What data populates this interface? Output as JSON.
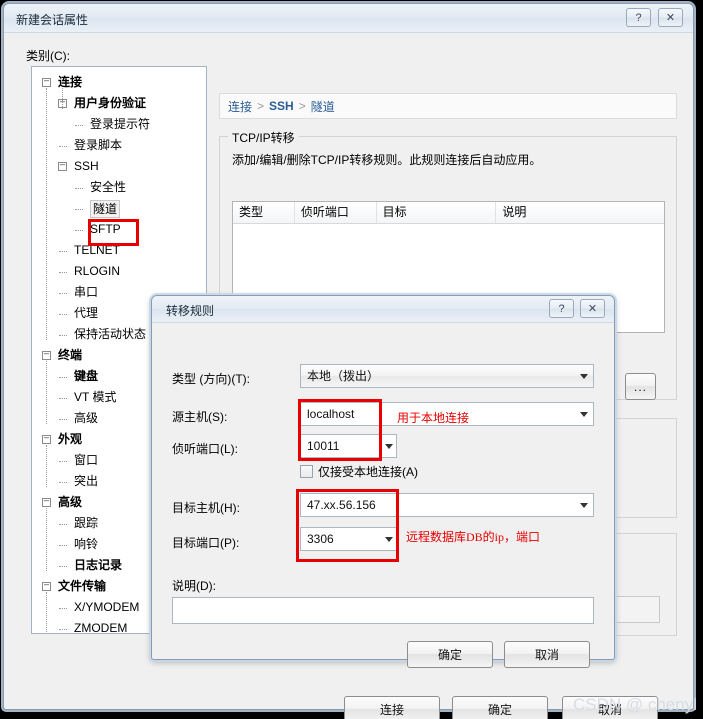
{
  "window": {
    "title": "新建会话属性",
    "help_button": "?",
    "close_button": "✕",
    "category_label": "类别(C):"
  },
  "tree": {
    "items": [
      {
        "label": "连接",
        "depth": 0,
        "bold": true,
        "expander": true,
        "selected": false
      },
      {
        "label": "用户身份验证",
        "depth": 1,
        "bold": true,
        "expander": true,
        "selected": false
      },
      {
        "label": "登录提示符",
        "depth": 2,
        "bold": false,
        "expander": false,
        "selected": false
      },
      {
        "label": "登录脚本",
        "depth": 1,
        "bold": false,
        "expander": false,
        "selected": false
      },
      {
        "label": "SSH",
        "depth": 1,
        "bold": false,
        "expander": true,
        "selected": false
      },
      {
        "label": "安全性",
        "depth": 2,
        "bold": false,
        "expander": false,
        "selected": false
      },
      {
        "label": "隧道",
        "depth": 2,
        "bold": false,
        "expander": false,
        "selected": true
      },
      {
        "label": "SFTP",
        "depth": 2,
        "bold": false,
        "expander": false,
        "selected": false
      },
      {
        "label": "TELNET",
        "depth": 1,
        "bold": false,
        "expander": false,
        "selected": false
      },
      {
        "label": "RLOGIN",
        "depth": 1,
        "bold": false,
        "expander": false,
        "selected": false
      },
      {
        "label": "串口",
        "depth": 1,
        "bold": false,
        "expander": false,
        "selected": false
      },
      {
        "label": "代理",
        "depth": 1,
        "bold": false,
        "expander": false,
        "selected": false
      },
      {
        "label": "保持活动状态",
        "depth": 1,
        "bold": false,
        "expander": false,
        "selected": false
      },
      {
        "label": "终端",
        "depth": 0,
        "bold": true,
        "expander": true,
        "selected": false
      },
      {
        "label": "键盘",
        "depth": 1,
        "bold": true,
        "expander": false,
        "selected": false
      },
      {
        "label": "VT 模式",
        "depth": 1,
        "bold": false,
        "expander": false,
        "selected": false
      },
      {
        "label": "高级",
        "depth": 1,
        "bold": false,
        "expander": false,
        "selected": false
      },
      {
        "label": "外观",
        "depth": 0,
        "bold": true,
        "expander": true,
        "selected": false
      },
      {
        "label": "窗口",
        "depth": 1,
        "bold": false,
        "expander": false,
        "selected": false
      },
      {
        "label": "突出",
        "depth": 1,
        "bold": false,
        "expander": false,
        "selected": false
      },
      {
        "label": "高级",
        "depth": 0,
        "bold": true,
        "expander": true,
        "selected": false
      },
      {
        "label": "跟踪",
        "depth": 1,
        "bold": false,
        "expander": false,
        "selected": false
      },
      {
        "label": "响铃",
        "depth": 1,
        "bold": false,
        "expander": false,
        "selected": false
      },
      {
        "label": "日志记录",
        "depth": 1,
        "bold": true,
        "expander": false,
        "selected": false
      },
      {
        "label": "文件传输",
        "depth": 0,
        "bold": true,
        "expander": true,
        "selected": false
      },
      {
        "label": "X/YMODEM",
        "depth": 1,
        "bold": false,
        "expander": false,
        "selected": false
      },
      {
        "label": "ZMODEM",
        "depth": 1,
        "bold": false,
        "expander": false,
        "selected": false
      }
    ]
  },
  "breadcrumb": {
    "crumb1": "连接",
    "sep1": ">",
    "crumb2": "SSH",
    "sep2": ">",
    "crumb3": "隧道"
  },
  "main_panel": {
    "group_title": "TCP/IP转移",
    "description": "添加/编辑/删除TCP/IP转移规则。此规则连接后自动应用。",
    "table": {
      "columns": [
        "类型",
        "侦听端口",
        "目标",
        "说明"
      ],
      "rows": []
    },
    "browse_button": "..."
  },
  "buttons": {
    "connect": "连接",
    "ok": "确定",
    "cancel": "取消"
  },
  "modal": {
    "title": "转移规则",
    "help_button": "?",
    "close_button": "✕",
    "fields": {
      "type_label": "类型 (方向)(T):",
      "type_value": "本地（拨出）",
      "source_host_label": "源主机(S):",
      "source_host_value": "localhost",
      "listen_port_label": "侦听端口(L):",
      "listen_port_value": "10011",
      "local_only_label": "仅接受本地连接(A)",
      "dest_host_label": "目标主机(H):",
      "dest_host_value": "47.xx.56.156",
      "dest_port_label": "目标端口(P):",
      "dest_port_value": "3306",
      "description_label": "说明(D):",
      "description_value": ""
    },
    "annotations": {
      "local": "用于本地连接",
      "remote": "远程数据库DB的ip，端口"
    },
    "buttons": {
      "ok": "确定",
      "cancel": "取消"
    }
  },
  "watermark": "CSDN @ chenyl",
  "colors": {
    "annotation_red": "#e80000",
    "link_blue": "#2b5c96",
    "titlebar": "#e2eaf3"
  }
}
